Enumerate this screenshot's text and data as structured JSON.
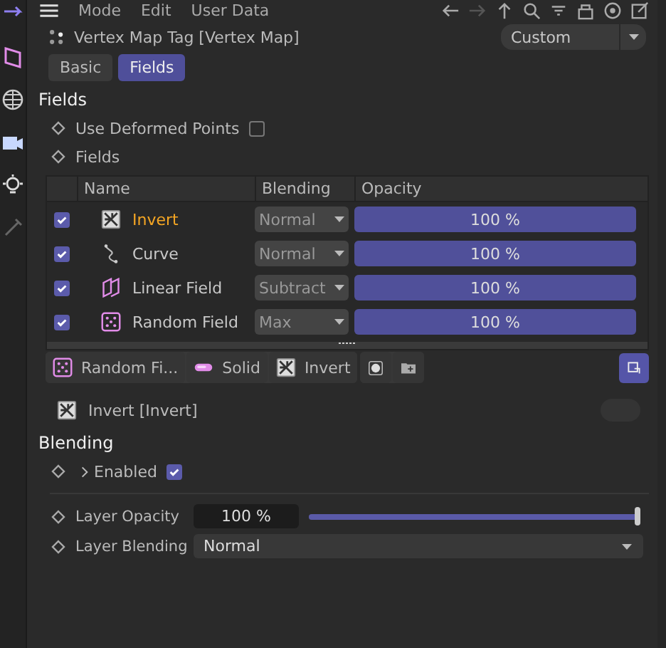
{
  "menu": [
    "Mode",
    "Edit",
    "User Data"
  ],
  "header": {
    "title": "Vertex Map Tag [Vertex Map]",
    "preset": "Custom"
  },
  "tabs": [
    {
      "label": "Basic",
      "selected": false
    },
    {
      "label": "Fields",
      "selected": true
    }
  ],
  "fields_section": {
    "title": "Fields",
    "use_deformed_points": {
      "label": "Use Deformed Points",
      "checked": false
    },
    "fields_label": "Fields"
  },
  "table": {
    "columns": [
      "Name",
      "Blending",
      "Opacity"
    ],
    "rows": [
      {
        "enabled": true,
        "kind": "invert",
        "name": "Invert",
        "selected": true,
        "blending": "Normal",
        "opacity": "100 %",
        "level": 1
      },
      {
        "enabled": true,
        "kind": "curve",
        "name": "Curve",
        "selected": false,
        "blending": "Normal",
        "opacity": "100 %",
        "level": 1
      },
      {
        "enabled": true,
        "kind": "linear",
        "name": "Linear Field",
        "selected": false,
        "blending": "Subtract",
        "opacity": "100 %",
        "level": 1
      },
      {
        "enabled": true,
        "kind": "random",
        "name": "Random Field",
        "selected": false,
        "blending": "Max",
        "opacity": "100 %",
        "level": 1
      }
    ]
  },
  "toolbar": [
    {
      "kind": "random",
      "label": "Random Fi..."
    },
    {
      "kind": "solid",
      "label": "Solid"
    },
    {
      "kind": "invert",
      "label": "Invert"
    }
  ],
  "layer": {
    "title": "Invert [Invert]",
    "blending_title": "Blending",
    "enabled": {
      "label": "Enabled",
      "checked": true
    },
    "opacity": {
      "label": "Layer Opacity",
      "value": "100 %",
      "level": 1
    },
    "blend": {
      "label": "Layer Blending",
      "value": "Normal"
    }
  }
}
